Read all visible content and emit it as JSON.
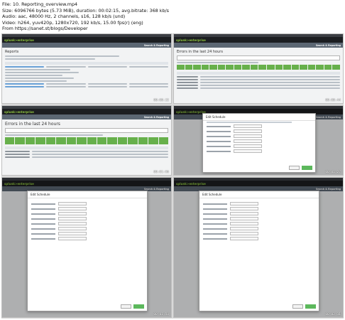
{
  "metadata": {
    "file": "File: 10. Reporting_overview.mp4",
    "size": "Size: 6096766 bytes (5.73 MiB), duration: 00:02:15, avg.bitrate: 368 kb/s",
    "audio": "Audio: aac, 48000 Hz, 2 channels, s16, 128 kb/s (und)",
    "video": "Video: h264, yuv420p, 1280x720, 192 kb/s, 15.00 fps(r) (eng)",
    "source": "From https://sanet.st/blogs/Developer"
  },
  "tiles": [
    {
      "title": "Reports",
      "stamp": "00:00:22"
    },
    {
      "title": "Errors in the last 24 hours",
      "stamp": "00:00:44"
    },
    {
      "title": "Errors in the last 24 hours",
      "stamp": "00:01:06"
    },
    {
      "title": "Edit Schedule",
      "stamp": "00:01:27"
    },
    {
      "title": "Edit Schedule",
      "stamp": "00:01:50"
    },
    {
      "title": "Edit Schedule",
      "stamp": "00:02:11"
    }
  ],
  "app": {
    "logo": "splunk>enterprise",
    "app_title": "Search & Reporting"
  }
}
